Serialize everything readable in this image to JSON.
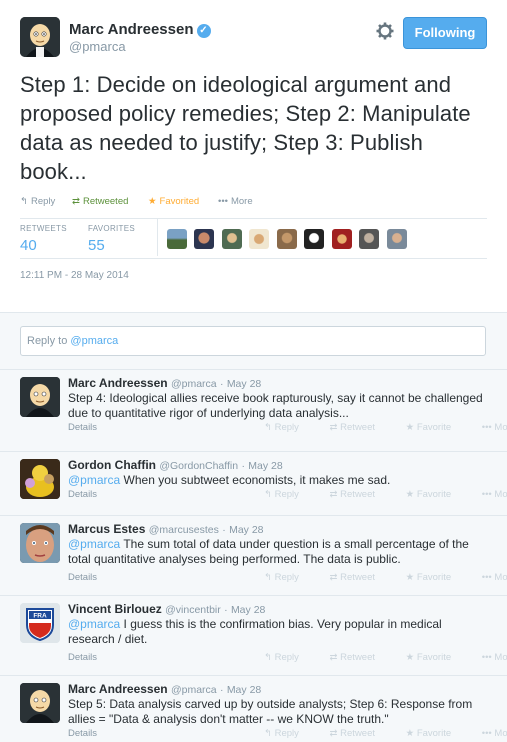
{
  "tweet": {
    "author_name": "Marc Andreessen",
    "author_handle": "@pmarca",
    "follow_label": "Following",
    "text": "Step 1: Decide on ideological argument and proposed policy remedies; Step 2: Manipulate data as needed to justify; Step 3: Publish book...",
    "actions": {
      "reply": "Reply",
      "retweet": "Retweeted",
      "favorite": "Favorited",
      "more": "More"
    },
    "stats": {
      "retweets_label": "RETWEETS",
      "retweets": "40",
      "favorites_label": "FAVORITES",
      "favorites": "55"
    },
    "timestamp": "12:11 PM - 28 May 2014",
    "colors": {
      "accent": "#55acee",
      "retweet": "#5c913b",
      "favorite": "#ffac33"
    }
  },
  "reply_box": {
    "prefix": "Reply to ",
    "mention": "@pmarca"
  },
  "replies": [
    {
      "name": "Marc Andreessen",
      "handle": "@pmarca",
      "time": "May 28",
      "mention": "",
      "text": "Step 4: Ideological allies receive book rapturously, say it cannot be challenged due to quantitative rigor of underlying data analysis...",
      "details": "Details",
      "reply": "Reply",
      "retweet": "Retweet",
      "favorite": "Favorite",
      "more": "More"
    },
    {
      "name": "Gordon Chaffin",
      "handle": "@GordonChaffin",
      "time": "May 28",
      "mention": "@pmarca",
      "text": " When you subtweet economists, it makes me sad.",
      "details": "Details",
      "reply": "Reply",
      "retweet": "Retweet",
      "favorite": "Favorite",
      "more": "More"
    },
    {
      "name": "Marcus Estes",
      "handle": "@marcusestes",
      "time": "May 28",
      "mention": "@pmarca",
      "text": " The sum total of data under question is a small percentage of the total quantitative analyses being performed. The data is public.",
      "details": "Details",
      "reply": "Reply",
      "retweet": "Retweet",
      "favorite": "Favorite",
      "more": "More"
    },
    {
      "name": "Vincent Birlouez",
      "handle": "@vincentbir",
      "time": "May 28",
      "mention": "@pmarca",
      "text": " I guess this is the confirmation bias. Very popular in medical research / diet.",
      "details": "Details",
      "reply": "Reply",
      "retweet": "Retweet",
      "favorite": "Favorite",
      "more": "More"
    },
    {
      "name": "Marc Andreessen",
      "handle": "@pmarca",
      "time": "May 28",
      "mention": "",
      "text": "Step 5: Data analysis carved up by outside analysts; Step 6: Response from allies = \"Data & analysis don't matter -- we KNOW the truth.\"",
      "details": "Details",
      "reply": "Reply",
      "retweet": "Retweet",
      "favorite": "Favorite",
      "more": "More"
    }
  ],
  "badge_text": "FRA"
}
